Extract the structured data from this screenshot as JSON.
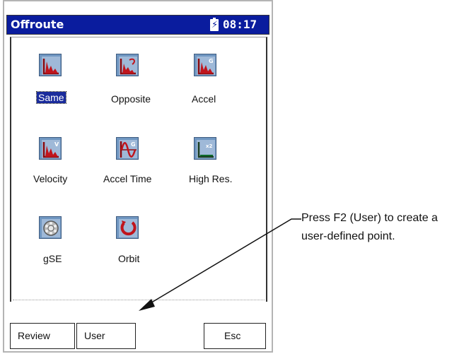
{
  "window": {
    "title": "Offroute",
    "time": "08:17"
  },
  "tiles": [
    {
      "label": "Same",
      "icon": "spectrum-same-icon",
      "selected": true
    },
    {
      "label": "Opposite",
      "icon": "spectrum-opposite-icon"
    },
    {
      "label": "Accel",
      "icon": "spectrum-accel-icon"
    },
    {
      "label": "Velocity",
      "icon": "spectrum-velocity-icon"
    },
    {
      "label": "Accel Time",
      "icon": "accel-time-waveform-icon"
    },
    {
      "label": "High Res.",
      "icon": "high-res-spectrum-icon"
    },
    {
      "label": "gSE",
      "icon": "gse-bearing-icon"
    },
    {
      "label": "Orbit",
      "icon": "orbit-icon"
    }
  ],
  "softkeys": {
    "review": "Review",
    "user": "User",
    "esc": "Esc"
  },
  "callout": {
    "line1": "Press F2 (User) to create a",
    "line2": "user-defined point."
  },
  "colors": {
    "titlebar": "#0a1c9e",
    "icon_bg": "#6f96c1",
    "icon_red": "#c0141c"
  }
}
